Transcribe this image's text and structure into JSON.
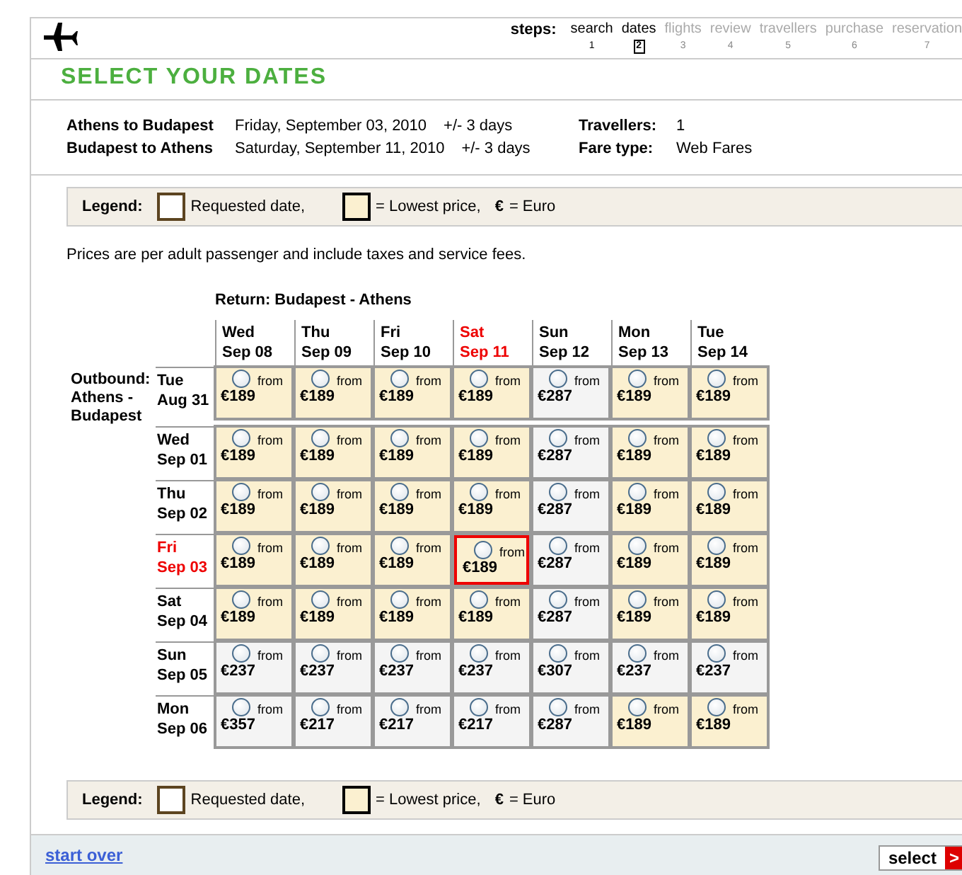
{
  "steps": {
    "label": "steps:",
    "items": [
      {
        "label": "search",
        "number": "1",
        "selected": false,
        "disabled": false
      },
      {
        "label": "dates",
        "number": "2",
        "selected": true,
        "disabled": false
      },
      {
        "label": "flights",
        "number": "3",
        "selected": false,
        "disabled": true
      },
      {
        "label": "review",
        "number": "4",
        "selected": false,
        "disabled": true
      },
      {
        "label": "travellers",
        "number": "5",
        "selected": false,
        "disabled": true
      },
      {
        "label": "purchase",
        "number": "6",
        "selected": false,
        "disabled": true
      },
      {
        "label": "reservation",
        "number": "7",
        "selected": false,
        "disabled": true
      }
    ]
  },
  "title": "SELECT YOUR DATES",
  "trips": [
    {
      "route": "Athens to Budapest",
      "date": "Friday, September 03, 2010",
      "range": "+/- 3 days"
    },
    {
      "route": "Budapest to Athens",
      "date": "Saturday, September 11, 2010",
      "range": "+/- 3 days"
    }
  ],
  "details": [
    {
      "label": "Travellers:",
      "value": "1"
    },
    {
      "label": "Fare type:",
      "value": "Web Fares"
    }
  ],
  "legends": [
    {
      "label": "Legend:",
      "requested": "Requested date,",
      "lowest": "= Lowest price,",
      "currency_sign": "€",
      "currency": "= Euro"
    },
    {
      "label": "Legend:",
      "requested": "Requested date,",
      "lowest": "= Lowest price,",
      "currency_sign": "€",
      "currency": "= Euro"
    }
  ],
  "note": "Prices are per adult passenger and include taxes and service fees.",
  "grid": {
    "return_title": "Return: Budapest - Athens",
    "outbound_title": "Outbound: Athens - Budapest",
    "columns": [
      {
        "day": "Wed",
        "date": "Sep 08",
        "requested": false
      },
      {
        "day": "Thu",
        "date": "Sep 09",
        "requested": false
      },
      {
        "day": "Fri",
        "date": "Sep 10",
        "requested": false
      },
      {
        "day": "Sat",
        "date": "Sep 11",
        "requested": true
      },
      {
        "day": "Sun",
        "date": "Sep 12",
        "requested": false
      },
      {
        "day": "Mon",
        "date": "Sep 13",
        "requested": false
      },
      {
        "day": "Tue",
        "date": "Sep 14",
        "requested": false
      }
    ],
    "rows": [
      {
        "day": "Tue",
        "date": "Aug 31",
        "requested": false,
        "cells": [
          {
            "from": "from",
            "price": "€189",
            "lowest": true,
            "requested": false
          },
          {
            "from": "from",
            "price": "€189",
            "lowest": true,
            "requested": false
          },
          {
            "from": "from",
            "price": "€189",
            "lowest": true,
            "requested": false
          },
          {
            "from": "from",
            "price": "€189",
            "lowest": true,
            "requested": false
          },
          {
            "from": "from",
            "price": "€287",
            "lowest": false,
            "requested": false
          },
          {
            "from": "from",
            "price": "€189",
            "lowest": true,
            "requested": false
          },
          {
            "from": "from",
            "price": "€189",
            "lowest": true,
            "requested": false
          }
        ]
      },
      {
        "day": "Wed",
        "date": "Sep 01",
        "requested": false,
        "cells": [
          {
            "from": "from",
            "price": "€189",
            "lowest": true,
            "requested": false
          },
          {
            "from": "from",
            "price": "€189",
            "lowest": true,
            "requested": false
          },
          {
            "from": "from",
            "price": "€189",
            "lowest": true,
            "requested": false
          },
          {
            "from": "from",
            "price": "€189",
            "lowest": true,
            "requested": false
          },
          {
            "from": "from",
            "price": "€287",
            "lowest": false,
            "requested": false
          },
          {
            "from": "from",
            "price": "€189",
            "lowest": true,
            "requested": false
          },
          {
            "from": "from",
            "price": "€189",
            "lowest": true,
            "requested": false
          }
        ]
      },
      {
        "day": "Thu",
        "date": "Sep 02",
        "requested": false,
        "cells": [
          {
            "from": "from",
            "price": "€189",
            "lowest": true,
            "requested": false
          },
          {
            "from": "from",
            "price": "€189",
            "lowest": true,
            "requested": false
          },
          {
            "from": "from",
            "price": "€189",
            "lowest": true,
            "requested": false
          },
          {
            "from": "from",
            "price": "€189",
            "lowest": true,
            "requested": false
          },
          {
            "from": "from",
            "price": "€287",
            "lowest": false,
            "requested": false
          },
          {
            "from": "from",
            "price": "€189",
            "lowest": true,
            "requested": false
          },
          {
            "from": "from",
            "price": "€189",
            "lowest": true,
            "requested": false
          }
        ]
      },
      {
        "day": "Fri",
        "date": "Sep 03",
        "requested": true,
        "cells": [
          {
            "from": "from",
            "price": "€189",
            "lowest": true,
            "requested": false
          },
          {
            "from": "from",
            "price": "€189",
            "lowest": true,
            "requested": false
          },
          {
            "from": "from",
            "price": "€189",
            "lowest": true,
            "requested": false
          },
          {
            "from": "from",
            "price": "€189",
            "lowest": true,
            "requested": true
          },
          {
            "from": "from",
            "price": "€287",
            "lowest": false,
            "requested": false
          },
          {
            "from": "from",
            "price": "€189",
            "lowest": true,
            "requested": false
          },
          {
            "from": "from",
            "price": "€189",
            "lowest": true,
            "requested": false
          }
        ]
      },
      {
        "day": "Sat",
        "date": "Sep 04",
        "requested": false,
        "cells": [
          {
            "from": "from",
            "price": "€189",
            "lowest": true,
            "requested": false
          },
          {
            "from": "from",
            "price": "€189",
            "lowest": true,
            "requested": false
          },
          {
            "from": "from",
            "price": "€189",
            "lowest": true,
            "requested": false
          },
          {
            "from": "from",
            "price": "€189",
            "lowest": true,
            "requested": false
          },
          {
            "from": "from",
            "price": "€287",
            "lowest": false,
            "requested": false
          },
          {
            "from": "from",
            "price": "€189",
            "lowest": true,
            "requested": false
          },
          {
            "from": "from",
            "price": "€189",
            "lowest": true,
            "requested": false
          }
        ]
      },
      {
        "day": "Sun",
        "date": "Sep 05",
        "requested": false,
        "cells": [
          {
            "from": "from",
            "price": "€237",
            "lowest": false,
            "requested": false
          },
          {
            "from": "from",
            "price": "€237",
            "lowest": false,
            "requested": false
          },
          {
            "from": "from",
            "price": "€237",
            "lowest": false,
            "requested": false
          },
          {
            "from": "from",
            "price": "€237",
            "lowest": false,
            "requested": false
          },
          {
            "from": "from",
            "price": "€307",
            "lowest": false,
            "requested": false
          },
          {
            "from": "from",
            "price": "€237",
            "lowest": false,
            "requested": false
          },
          {
            "from": "from",
            "price": "€237",
            "lowest": false,
            "requested": false
          }
        ]
      },
      {
        "day": "Mon",
        "date": "Sep 06",
        "requested": false,
        "cells": [
          {
            "from": "from",
            "price": "€357",
            "lowest": false,
            "requested": false
          },
          {
            "from": "from",
            "price": "€217",
            "lowest": false,
            "requested": false
          },
          {
            "from": "from",
            "price": "€217",
            "lowest": false,
            "requested": false
          },
          {
            "from": "from",
            "price": "€217",
            "lowest": false,
            "requested": false
          },
          {
            "from": "from",
            "price": "€287",
            "lowest": false,
            "requested": false
          },
          {
            "from": "from",
            "price": "€189",
            "lowest": true,
            "requested": false
          },
          {
            "from": "from",
            "price": "€189",
            "lowest": true,
            "requested": false
          }
        ]
      }
    ]
  },
  "footer": {
    "link": "start over",
    "button": "select",
    "button_arrow": ">"
  }
}
